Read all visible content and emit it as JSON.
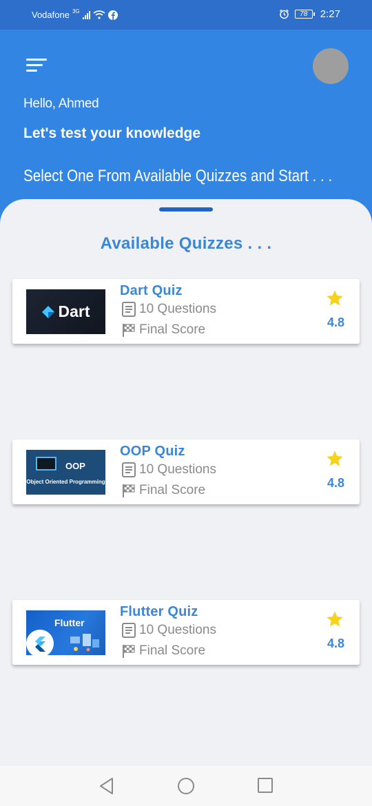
{
  "status_bar": {
    "carrier": "Vodafone",
    "network": "3G",
    "battery": "78",
    "time": "2:27"
  },
  "header": {
    "greeting": "Hello, Ahmed",
    "headline": "Let's test your knowledge",
    "subline": "Select One From Available Quizzes and Start . . ."
  },
  "sheet": {
    "title": "Available Quizzes . . ."
  },
  "quizzes": [
    {
      "title": "Dart Quiz",
      "questions": "10 Questions",
      "score_label": "Final Score",
      "rating": "4.8",
      "thumb_label": "Dart"
    },
    {
      "title": "OOP Quiz",
      "questions": "10 Questions",
      "score_label": "Final Score",
      "rating": "4.8",
      "thumb_label": "OOP",
      "thumb_sub": "Object Oriented Programming"
    },
    {
      "title": "Flutter Quiz",
      "questions": "10 Questions",
      "score_label": "Final Score",
      "rating": "4.8",
      "thumb_label": "Flutter"
    }
  ],
  "colors": {
    "primary": "#3385e3",
    "status_bar": "#2d6fca",
    "accent_text": "#3a86d8",
    "star": "#f5d31c",
    "background": "#f0f1f4"
  },
  "icons": [
    "menu-icon",
    "document-icon",
    "checkered-flag-icon",
    "star-icon",
    "back-icon",
    "home-icon",
    "recents-icon"
  ]
}
